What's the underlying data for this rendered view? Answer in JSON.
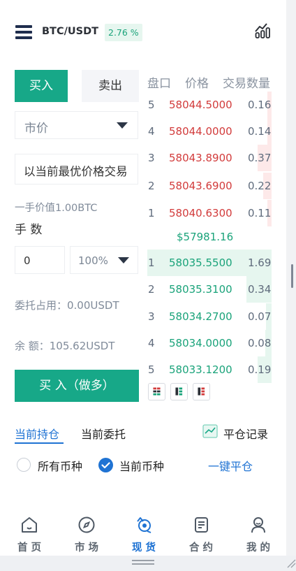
{
  "header": {
    "pair": "BTC/USDT",
    "change": "2.76 %"
  },
  "trade": {
    "buy_tab": "买入",
    "sell_tab": "卖出",
    "order_type": "市价",
    "price_input": "以当前最优价格交易",
    "lot_value": "一手价值1.00BTC",
    "qty_label": "手 数",
    "qty_value": "0",
    "percent_value": "100%",
    "margin_used": "委托占用：0.00USDT",
    "balance": "余 额：105.62USDT",
    "submit_label": "买 入（做多）"
  },
  "orderbook": {
    "headers": [
      "盘口",
      "价格",
      "交易数量"
    ],
    "asks": [
      {
        "level": "5",
        "price": "58044.5000",
        "amount": "0.16"
      },
      {
        "level": "4",
        "price": "58044.0000",
        "amount": "0.14"
      },
      {
        "level": "3",
        "price": "58043.8900",
        "amount": "0.37"
      },
      {
        "level": "2",
        "price": "58043.6900",
        "amount": "0.22"
      },
      {
        "level": "1",
        "price": "58040.6300",
        "amount": "0.11"
      }
    ],
    "last_price": "$57981.16",
    "bids": [
      {
        "level": "1",
        "price": "58035.5500",
        "amount": "1.69"
      },
      {
        "level": "2",
        "price": "58035.3100",
        "amount": "0.34"
      },
      {
        "level": "3",
        "price": "58034.2700",
        "amount": "0.07"
      },
      {
        "level": "4",
        "price": "58034.0000",
        "amount": "0.08"
      },
      {
        "level": "5",
        "price": "58033.1200",
        "amount": "0.19"
      }
    ],
    "colors": {
      "ask": "#d23b3b",
      "bid": "#1aa37a"
    }
  },
  "positions": {
    "tab_current": "当前持仓",
    "tab_orders": "当前委托",
    "history": "平仓记录",
    "filter_all": "所有币种",
    "filter_current": "当前币种",
    "close_all": "一键平仓"
  },
  "tabbar": [
    {
      "label": "首 页",
      "icon": "home-icon"
    },
    {
      "label": "市 场",
      "icon": "compass-icon"
    },
    {
      "label": "现 货",
      "icon": "spot-exchange-icon",
      "active": true
    },
    {
      "label": "合 约",
      "icon": "contract-icon"
    },
    {
      "label": "我 的",
      "icon": "profile-icon"
    }
  ],
  "theme": {
    "primary_green": "#17a888",
    "link_blue": "#1f73d3"
  }
}
